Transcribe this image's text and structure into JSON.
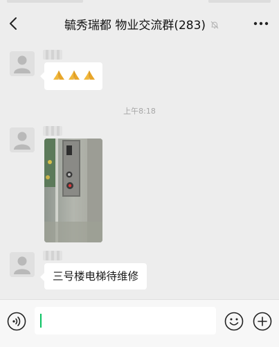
{
  "header": {
    "title": "毓秀瑞都 物业交流群(283)"
  },
  "messages": [
    {
      "type": "emoji",
      "sender_avatar": "default-avatar",
      "emojis": [
        "folded-hands-emoji",
        "folded-hands-emoji",
        "folded-hands-emoji"
      ]
    },
    {
      "type": "time",
      "text": "上午8:18"
    },
    {
      "type": "image",
      "sender_avatar": "default-avatar",
      "image": "elevator-button-panel-photo"
    },
    {
      "type": "text",
      "sender_avatar": "default-avatar",
      "text": "三号楼电梯待维修"
    }
  ],
  "input": {
    "value": ""
  },
  "icons": {
    "back": "chevron-left-icon",
    "mute": "bell-off-icon",
    "more": "more-icon",
    "voice": "voice-icon",
    "emoji": "smile-icon",
    "plus": "plus-icon"
  },
  "colors": {
    "background": "#ededed",
    "bubble": "#ffffff",
    "cursor": "#07c160",
    "timestamp": "#a7a7a7"
  }
}
